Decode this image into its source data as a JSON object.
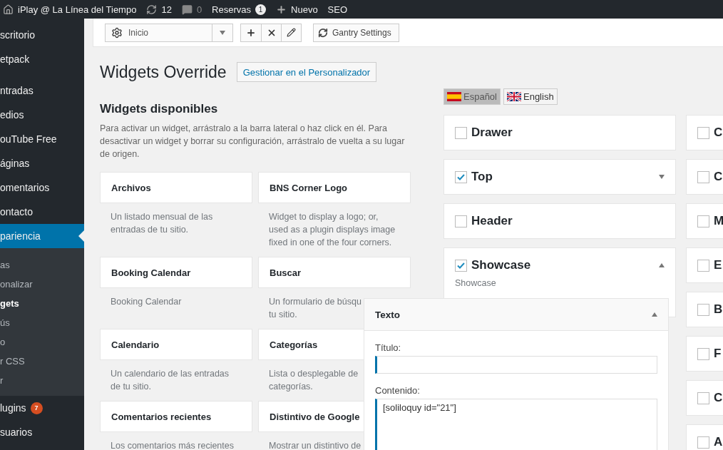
{
  "admin_bar": {
    "site": "iPlay @ La Línea del Tiempo",
    "updates": "12",
    "comments": "0",
    "bookings": {
      "label": "Reservas",
      "badge": "1"
    },
    "new": "Nuevo",
    "seo": "SEO"
  },
  "sidebar": {
    "items": [
      {
        "label": "scritorio",
        "selected": false
      },
      {
        "label": "etpack",
        "selected": false
      },
      {
        "label": "ntradas",
        "selected": false
      },
      {
        "label": "edios",
        "selected": false
      },
      {
        "label": "ouTube Free",
        "selected": false
      },
      {
        "label": "áginas",
        "selected": false
      },
      {
        "label": "omentarios",
        "selected": false
      },
      {
        "label": "ontacto",
        "selected": false
      },
      {
        "label": "pariencia",
        "selected": true,
        "children": [
          {
            "label": "as",
            "selected": false
          },
          {
            "label": "onalizar",
            "selected": false
          },
          {
            "label": "gets",
            "selected": true
          },
          {
            "label": "ús",
            "selected": false
          },
          {
            "label": "o",
            "selected": false
          },
          {
            "label": "r CSS",
            "selected": false
          },
          {
            "label": "r",
            "selected": false
          }
        ]
      },
      {
        "label": "lugins",
        "selected": false,
        "badge": "7"
      },
      {
        "label": "suarios",
        "selected": false
      }
    ]
  },
  "toolbar": {
    "select": "Inicio",
    "settings_button": "Gantry Settings"
  },
  "page": {
    "title": "Widgets Override",
    "manage_button": "Gestionar en el Personalizador"
  },
  "available": {
    "heading": "Widgets disponibles",
    "description": "Para activar un widget, arrástralo a la barra lateral o haz click en él. Para desactivar un widget y borrar su configuración, arrástralo de vuelta a su lugar de origen.",
    "widgets": [
      {
        "name": "Archivos",
        "description_lines": [
          "Un listado mensual de las",
          "entradas de tu sitio."
        ]
      },
      {
        "name": "BNS Corner Logo",
        "description_lines": [
          "Widget to display a logo; or,",
          "used as a plugin displays image",
          "fixed in one of the four corners."
        ]
      },
      {
        "name": "Booking Calendar",
        "description_lines": [
          "Booking Calendar"
        ]
      },
      {
        "name": "Buscar",
        "description_lines": [
          "Un formulario de búsqu",
          "tu sitio."
        ]
      },
      {
        "name": "Calendario",
        "description_lines": [
          "Un calendario de las entradas",
          "de tu sitio."
        ]
      },
      {
        "name": "Categorías",
        "description_lines": [
          "Lista o desplegable de",
          "categorías."
        ]
      },
      {
        "name": "Comentarios recientes",
        "description_lines": [
          "Los comentarios más recientes"
        ]
      },
      {
        "name": "Distintivo de Google",
        "description_lines": [
          "Mostrar un distintivo de"
        ]
      }
    ]
  },
  "languages": [
    {
      "label": "Español",
      "kind": "spain",
      "selected": true
    },
    {
      "label": "English",
      "kind": "uk",
      "selected": false
    }
  ],
  "sidebar_columns": [
    [
      {
        "name": "Drawer",
        "checked": false
      },
      {
        "name": "Top",
        "checked": true,
        "expanded": false
      },
      {
        "name": "Header",
        "checked": false
      },
      {
        "name": "Showcase",
        "checked": true,
        "expanded": true,
        "description": "Showcase"
      }
    ],
    [
      {
        "name": "C",
        "checked": false
      },
      {
        "name": "C",
        "checked": false
      },
      {
        "name": "M",
        "checked": false
      },
      {
        "name": "E",
        "checked": false
      },
      {
        "name": "B",
        "checked": false
      },
      {
        "name": "F",
        "checked": false
      },
      {
        "name": "C",
        "checked": false
      },
      {
        "name": "A",
        "checked": false
      }
    ]
  ],
  "editor": {
    "title": "Texto",
    "expanded": true,
    "fields": [
      {
        "label": "Título:",
        "kind": "input"
      },
      {
        "label": "Contenido:",
        "kind": "textarea",
        "value": "[soliloquy id=\"21\"]"
      }
    ]
  }
}
